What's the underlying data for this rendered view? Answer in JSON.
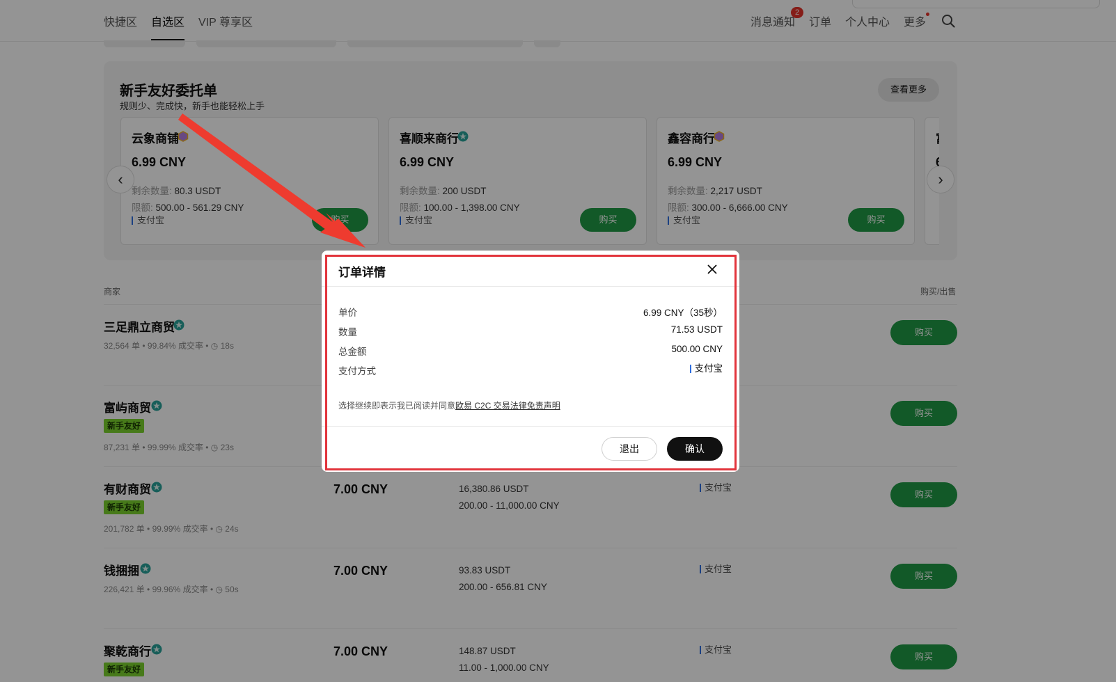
{
  "nav": {
    "tabs": [
      "快捷区",
      "自选区",
      "VIP 尊享区"
    ],
    "right": {
      "notifications": "消息通知",
      "notif_count": "2",
      "orders": "订单",
      "profile": "个人中心",
      "more": "更多"
    }
  },
  "beginner": {
    "title": "新手友好委托单",
    "subtitle": "规则少、完成快，新手也能轻松上手",
    "see_more": "查看更多",
    "available_label": "剩余数量:",
    "limit_label": "限额:",
    "buy_label": "购买",
    "cards": [
      {
        "name": "云象商铺",
        "price": "6.99 CNY",
        "available": "80.3 USDT",
        "limit": "500.00 - 561.29 CNY",
        "pay": "支付宝"
      },
      {
        "name": "喜顺来商行",
        "price": "6.99 CNY",
        "available": "200 USDT",
        "limit": "100.00 - 1,398.00 CNY",
        "pay": "支付宝"
      },
      {
        "name": "鑫容商行",
        "price": "6.99 CNY",
        "available": "2,217 USDT",
        "limit": "300.00 - 6,666.00 CNY",
        "pay": "支付宝"
      },
      {
        "name": "富",
        "price": "6",
        "available": "",
        "limit": "",
        "pay": ""
      }
    ]
  },
  "list": {
    "header_merchant": "商家",
    "header_action": "购买/出售",
    "buy_label": "购买",
    "rows": [
      {
        "name": "三足鼎立商贸",
        "tag": "",
        "stats": "32,564 单  •  99.84% 成交率  •  ◷ 18s",
        "price": "",
        "available": "",
        "limit": "",
        "pay": ""
      },
      {
        "name": "富屿商贸",
        "tag": "新手友好",
        "stats": "87,231 单  •  99.99% 成交率  •  ◷ 23s",
        "price": "",
        "available": "",
        "limit": "",
        "pay": ""
      },
      {
        "name": "有财商贸",
        "tag": "新手友好",
        "stats": "201,782 单  •  99.99% 成交率  •  ◷ 24s",
        "price": "7.00 CNY",
        "available": "16,380.86 USDT",
        "limit": "200.00 - 11,000.00 CNY",
        "pay": "支付宝"
      },
      {
        "name": "钱捆捆",
        "tag": "",
        "stats": "226,421 单  •  99.96% 成交率  •  ◷ 50s",
        "price": "7.00 CNY",
        "available": "93.83 USDT",
        "limit": "200.00 - 656.81 CNY",
        "pay": "支付宝"
      },
      {
        "name": "聚乾商行",
        "tag": "新手友好",
        "stats": "",
        "price": "7.00 CNY",
        "available": "148.87 USDT",
        "limit": "11.00 - 1,000.00 CNY",
        "pay": "支付宝"
      }
    ]
  },
  "modal": {
    "title": "订单详情",
    "rows": [
      {
        "label": "单价",
        "value": "6.99 CNY（35秒）"
      },
      {
        "label": "数量",
        "value": "71.53 USDT"
      },
      {
        "label": "总金额",
        "value": "500.00 CNY"
      },
      {
        "label": "支付方式",
        "value": "支付宝"
      }
    ],
    "agree_text": "选择继续即表示我已阅读并同意",
    "agree_link": "欧易 C2C 交易法律免责声明",
    "exit": "退出",
    "confirm": "确认"
  },
  "colors": {
    "buy_green": "#1f9a45",
    "highlight_red": "#e2343c",
    "tag_green": "#7ad22e",
    "confirm_black": "#111111"
  }
}
